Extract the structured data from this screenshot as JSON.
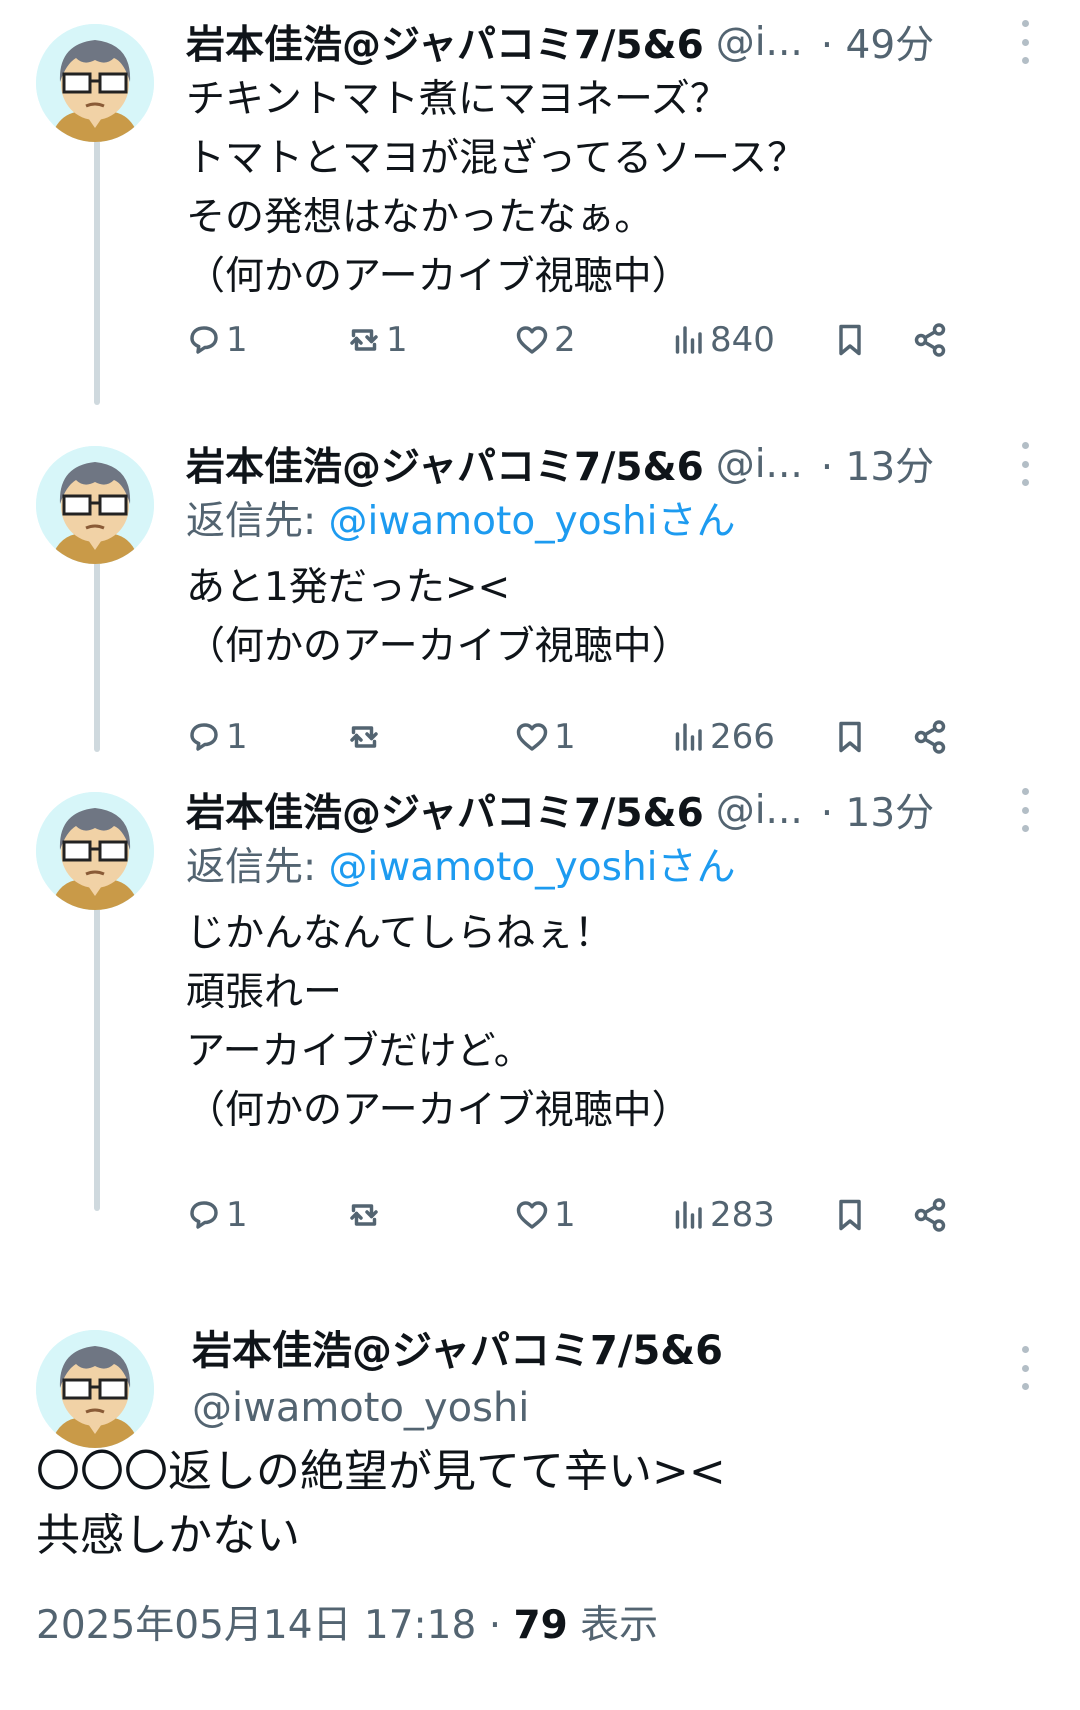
{
  "author": {
    "display_name": "岩本佳浩@ジャパコミ7/5&6",
    "handle_truncated": "@i...",
    "handle": "@iwamoto_yoshi"
  },
  "thread": [
    {
      "time": "· 49分",
      "reply_to": null,
      "text": "チキントマト煮にマヨネーズ？\nトマトとマヨが混ざってるソース？\nその発想はなかったなぁ。\n（何かのアーカイブ視聴中）",
      "replies": "1",
      "reposts": "1",
      "likes": "2",
      "views": "840"
    },
    {
      "time": "· 13分",
      "reply_to": {
        "prefix": "返信先: ",
        "mention": "@iwamoto_yoshiさん"
      },
      "text": "あと1発だった><\n（何かのアーカイブ視聴中）",
      "replies": "1",
      "reposts": "",
      "likes": "1",
      "views": "266"
    },
    {
      "time": "· 13分",
      "reply_to": {
        "prefix": "返信先: ",
        "mention": "@iwamoto_yoshiさん"
      },
      "text": "じかんなんてしらねぇ！\n頑張れー\nアーカイブだけど。\n（何かのアーカイブ視聴中）",
      "replies": "1",
      "reposts": "",
      "likes": "1",
      "views": "283"
    }
  ],
  "main_tweet": {
    "text": "〇〇〇返しの絶望が見てて辛い><\n共感しかない",
    "timestamp": "2025年05月14日 17:18 · ",
    "views_count": "79",
    "views_label": " 表示"
  },
  "icons": {
    "reply": "reply-icon",
    "repost": "repost-icon",
    "like": "heart-icon",
    "views": "views-icon",
    "bookmark": "bookmark-icon",
    "share": "share-icon",
    "more": "more-icon"
  },
  "colors": {
    "link": "#1d9bf0",
    "secondary": "#536471",
    "text": "#0f1419",
    "thread_line": "#cfd9de"
  }
}
